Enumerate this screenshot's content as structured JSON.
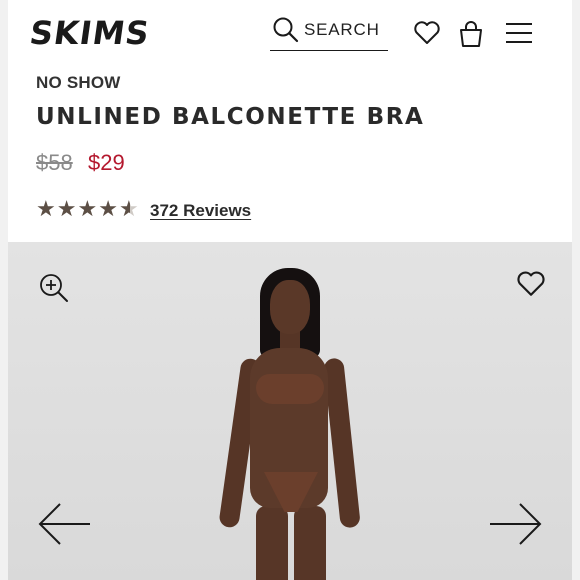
{
  "header": {
    "logo_text": "SKIMS",
    "search_label": "SEARCH",
    "icons": [
      "search-icon",
      "heart-icon",
      "bag-icon",
      "menu-icon"
    ]
  },
  "product": {
    "collection": "NO SHOW",
    "title": "UNLINED BALCONETTE BRA",
    "price_original": "$58",
    "price_sale": "$29",
    "rating": 4.5,
    "reviews_label": "372 Reviews"
  },
  "gallery": {
    "icons": [
      "zoom-in-icon",
      "heart-icon",
      "arrow-left-icon",
      "arrow-right-icon"
    ]
  },
  "colors": {
    "sale_red": "#b4182e",
    "star_brown": "#5c4f45",
    "text_dark": "#1a1a1a",
    "gallery_bg": "#e0e0e0"
  }
}
